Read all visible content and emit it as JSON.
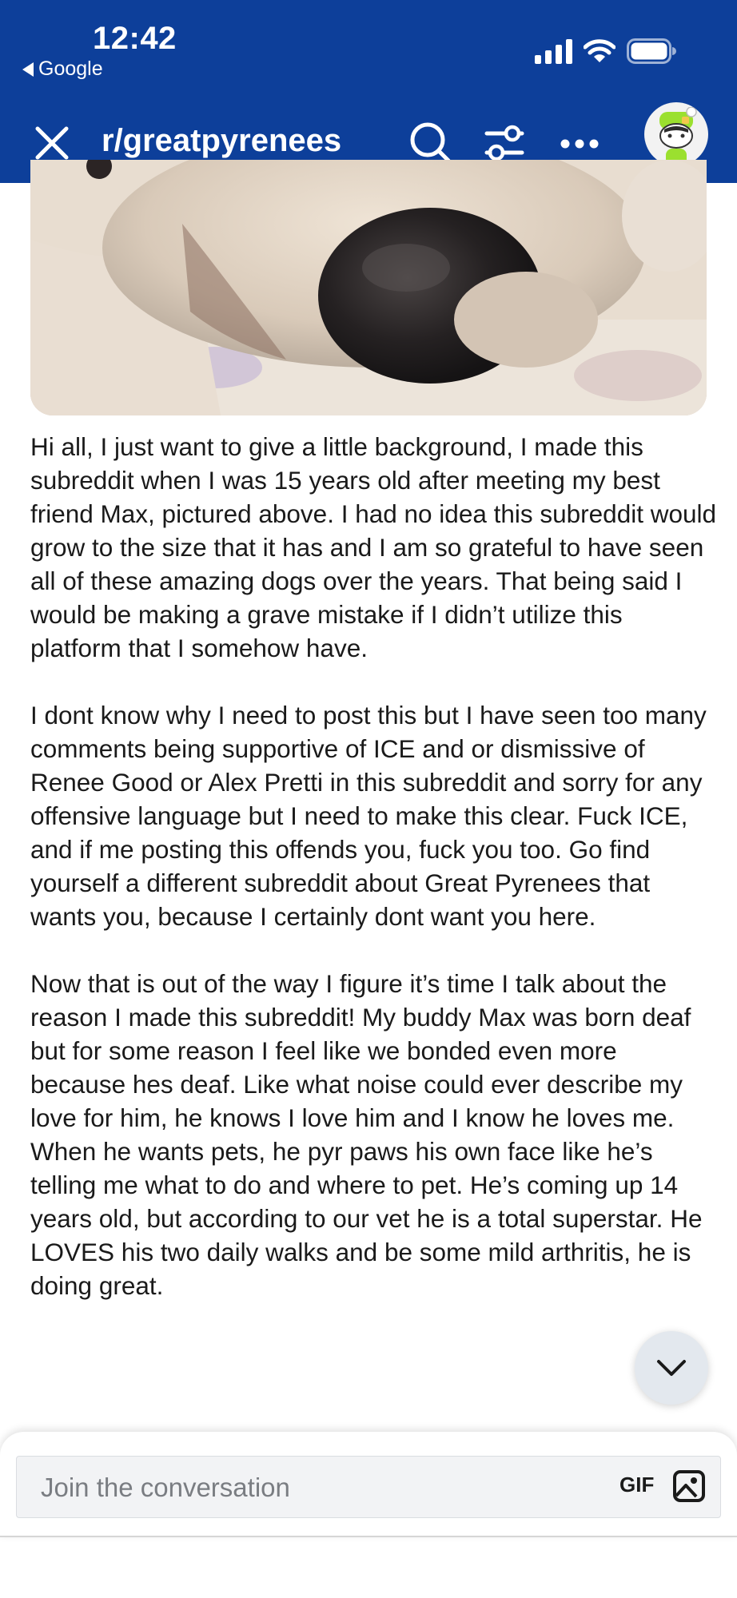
{
  "status_bar": {
    "time": "12:42",
    "back_app": "Google"
  },
  "toolbar": {
    "title": "r/greatpyrenees"
  },
  "post": {
    "paragraphs": [
      "Hi all, I just want to give a little background, I made this subreddit when I was 15 years old after meeting my best friend Max, pictured above. I had no idea this subreddit would grow to the size that it has and I am so grateful to have seen all of these amazing dogs over the years. That being said I would be making a grave mistake if I didn’t utilize this platform that I somehow have.",
      "I dont know why I need to post this but I have seen too many comments being supportive of ICE and or dismissive of Renee Good or Alex Pretti in this subreddit and sorry for any offensive language but I need to make this clear. Fuck ICE, and if me posting this offends you, fuck you too. Go find yourself a different subreddit about Great Pyrenees that wants you, because I certainly dont want you here.",
      "Now that is out of the way I figure it’s time I talk about the reason I made this subreddit! My buddy Max was born deaf but for some reason I feel like we bonded even more because hes deaf. Like what noise could ever describe my love for him, he knows I love him and I know he loves me. When he wants pets, he pyr paws his own face like he’s telling me what to do and where to pet. He’s coming up 14 years old, but according to our vet he is a total superstar. He LOVES his two daily walks and be some mild arthritis, he is doing great."
    ]
  },
  "comment_bar": {
    "placeholder": "Join the conversation",
    "gif_label": "GIF"
  },
  "colors": {
    "header_bg": "#0d3f9a",
    "text": "#1a1a1a",
    "input_bg": "#f2f3f5"
  },
  "icons": {
    "close": "close-icon",
    "search": "search-icon",
    "filter": "filter-icon",
    "more": "more-icon",
    "scroll_down": "chevron-down-icon",
    "image": "image-icon"
  }
}
